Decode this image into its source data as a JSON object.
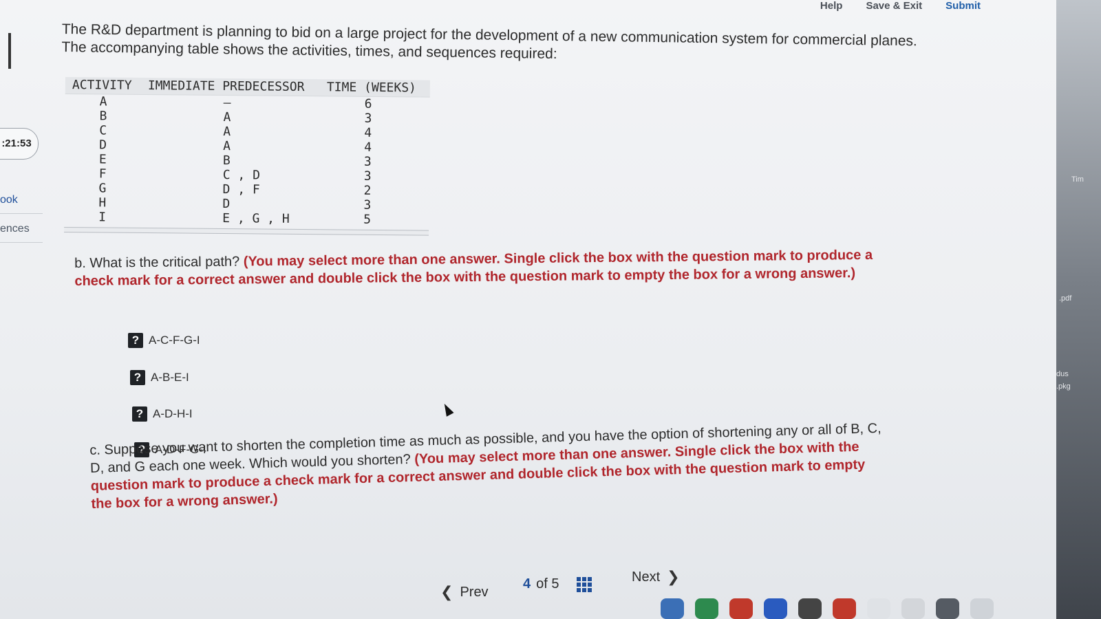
{
  "topbar": {
    "help": "Help",
    "save_exit": "Save & Exit",
    "submit": "Submit"
  },
  "sidebar": {
    "timer": ":21:53",
    "link1": "ook",
    "link2": "ences"
  },
  "intro": {
    "line1": "The R&D department is planning to bid on a large project for the development of a new communication system for commercial planes.",
    "line2": "The accompanying table shows the activities, times, and sequences required:"
  },
  "table": {
    "headers": [
      "ACTIVITY",
      "IMMEDIATE PREDECESSOR",
      "TIME (WEEKS)"
    ],
    "rows": [
      [
        "A",
        "—",
        "6"
      ],
      [
        "B",
        "A",
        "3"
      ],
      [
        "C",
        "A",
        "4"
      ],
      [
        "D",
        "A",
        "4"
      ],
      [
        "E",
        "B",
        "3"
      ],
      [
        "F",
        "C , D",
        "3"
      ],
      [
        "G",
        "D , F",
        "2"
      ],
      [
        "H",
        "D",
        "3"
      ],
      [
        "I",
        "E , G , H",
        "5"
      ]
    ]
  },
  "question_b": {
    "lead": "b. What is the critical path?",
    "instruction": "(You may select more than one answer. Single click the box with the question mark to produce a check mark for a correct answer and double click the box with the question mark to empty the box for a wrong answer.)",
    "box_symbol": "?",
    "options": [
      "A-C-F-G-I",
      "A-B-E-I",
      "A-D-H-I",
      "A-D-F-G-I"
    ]
  },
  "question_c": {
    "lead": "c. Suppose you want to shorten the completion time as much as possible, and you have the option of shortening any or all of B, C, D, and G each one week. Which would you shorten?",
    "instruction": "(You may select more than one answer. Single click the box with the question mark to produce a check mark for a correct answer and double click the box with the question mark to empty the box for a wrong answer.)"
  },
  "pager": {
    "prev": "Prev",
    "current": "4",
    "of": "of 5",
    "next": "Next"
  },
  "desktop": {
    "label1": ".pdf",
    "label2": "dus",
    "label3": ".pkg",
    "label4": "Tim"
  }
}
